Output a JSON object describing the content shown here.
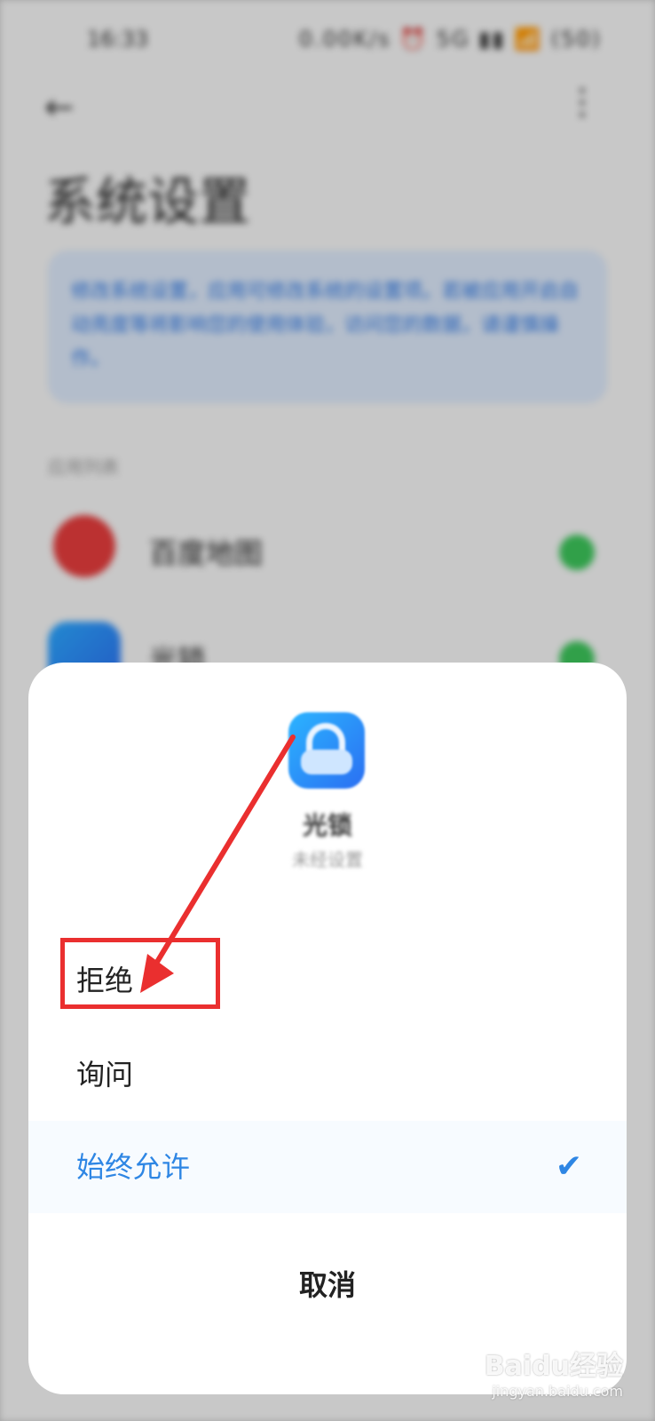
{
  "background": {
    "status_time": "16:33",
    "status_icons": "0.00K/s ⏰ 5G ▮▮ 📶 (50)",
    "page_title": "系统设置",
    "info_text": "修改系统设置，应用可修改系统的设置项。若被应用开启自动亮度等将影响您的使用体验，访问您的数据，请谨慎操作。",
    "section_label": "应用列表",
    "apps": [
      {
        "name": "百度地图"
      },
      {
        "name": "光锁"
      }
    ]
  },
  "dialog": {
    "app_name": "光锁",
    "app_subtitle": "未经设置",
    "options": [
      {
        "label": "拒绝",
        "selected": false
      },
      {
        "label": "询问",
        "selected": false
      },
      {
        "label": "始终允许",
        "selected": true
      }
    ],
    "check_glyph": "✔",
    "cancel_label": "取消"
  },
  "annotation": {
    "color": "#ea2f2f"
  },
  "watermark": {
    "brand": "Baidu经验",
    "url": "jingyan.baidu.com"
  },
  "colors": {
    "accent": "#2e86e4",
    "toggle_on": "#3cc45a"
  }
}
